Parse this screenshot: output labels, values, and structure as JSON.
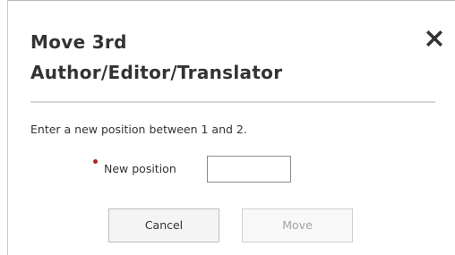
{
  "dialog": {
    "title_line1": "Move 3rd",
    "title_line2": "Author/Editor/Translator",
    "close_icon": "close-icon"
  },
  "form": {
    "instruction": "Enter a new position between 1 and 2.",
    "field_label": "New position",
    "field_value": "",
    "required": true
  },
  "buttons": {
    "cancel_label": "Cancel",
    "move_label": "Move",
    "move_disabled": true
  },
  "colors": {
    "title_text": "#333333",
    "required_marker": "#a7262a",
    "disabled_text": "#a3a3a3"
  }
}
